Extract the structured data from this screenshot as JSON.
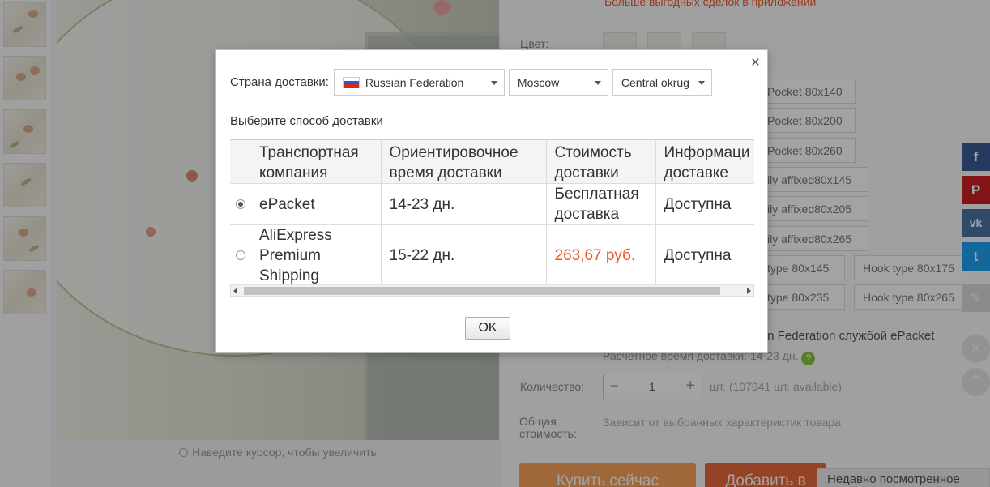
{
  "background": {
    "zoom_hint": "Наведите курсор, чтобы увеличить",
    "promo": "Больше выгодных сделок в приложении",
    "color_label": "Цвет:",
    "options": [
      "Pocket 80x140",
      "Pocket 80x200",
      "Pocket 80x260",
      "ily affixed80x145",
      "ily affixed80x205",
      "ily affixed80x265",
      "type 80x145",
      "Hook type 80x175",
      "type 80x235",
      "Hook type 80x265"
    ],
    "shipping_line": "sian Federation службой ePacket",
    "shipping_time": "Расчетное время доставки: 14-23 дн.",
    "help": "?",
    "quantity_label": "Количество:",
    "quantity_value": "1",
    "quantity_minus": "−",
    "quantity_plus": "+",
    "quantity_available": "шт. (107941 шт. available)",
    "total_label": "Общая стоимость:",
    "total_value": "Зависит от выбранных характеристик товара",
    "buy_now": "Купить сейчас",
    "add_to_cart": "Добавить в",
    "recently_viewed": "Недавно посмотренное",
    "share": {
      "facebook": "f",
      "pinterest": "P",
      "vk": "vk",
      "twitter": "t"
    }
  },
  "modal": {
    "close": "×",
    "country_label": "Страна доставки:",
    "country": "Russian Federation",
    "city": "Moscow",
    "region": "Central okrug",
    "section_title": "Выберите способ доставки",
    "columns": [
      "Транспортная компания",
      "Ориентировочное время доставки",
      "Стоимость доставки",
      "Информаци о доставке"
    ],
    "rows": [
      {
        "company": "ePacket",
        "time": "14-23 дн.",
        "cost": "Бесплатная доставка",
        "info": "Доступна",
        "selected": true
      },
      {
        "company": "AliExpress Premium Shipping",
        "time": "15-22 дн.",
        "cost": "263,67 руб.",
        "info": "Доступна",
        "selected": false
      }
    ],
    "ok": "OK"
  },
  "colors": {
    "accent_red": "#e8592a",
    "buy_orange": "#f7a35c"
  }
}
